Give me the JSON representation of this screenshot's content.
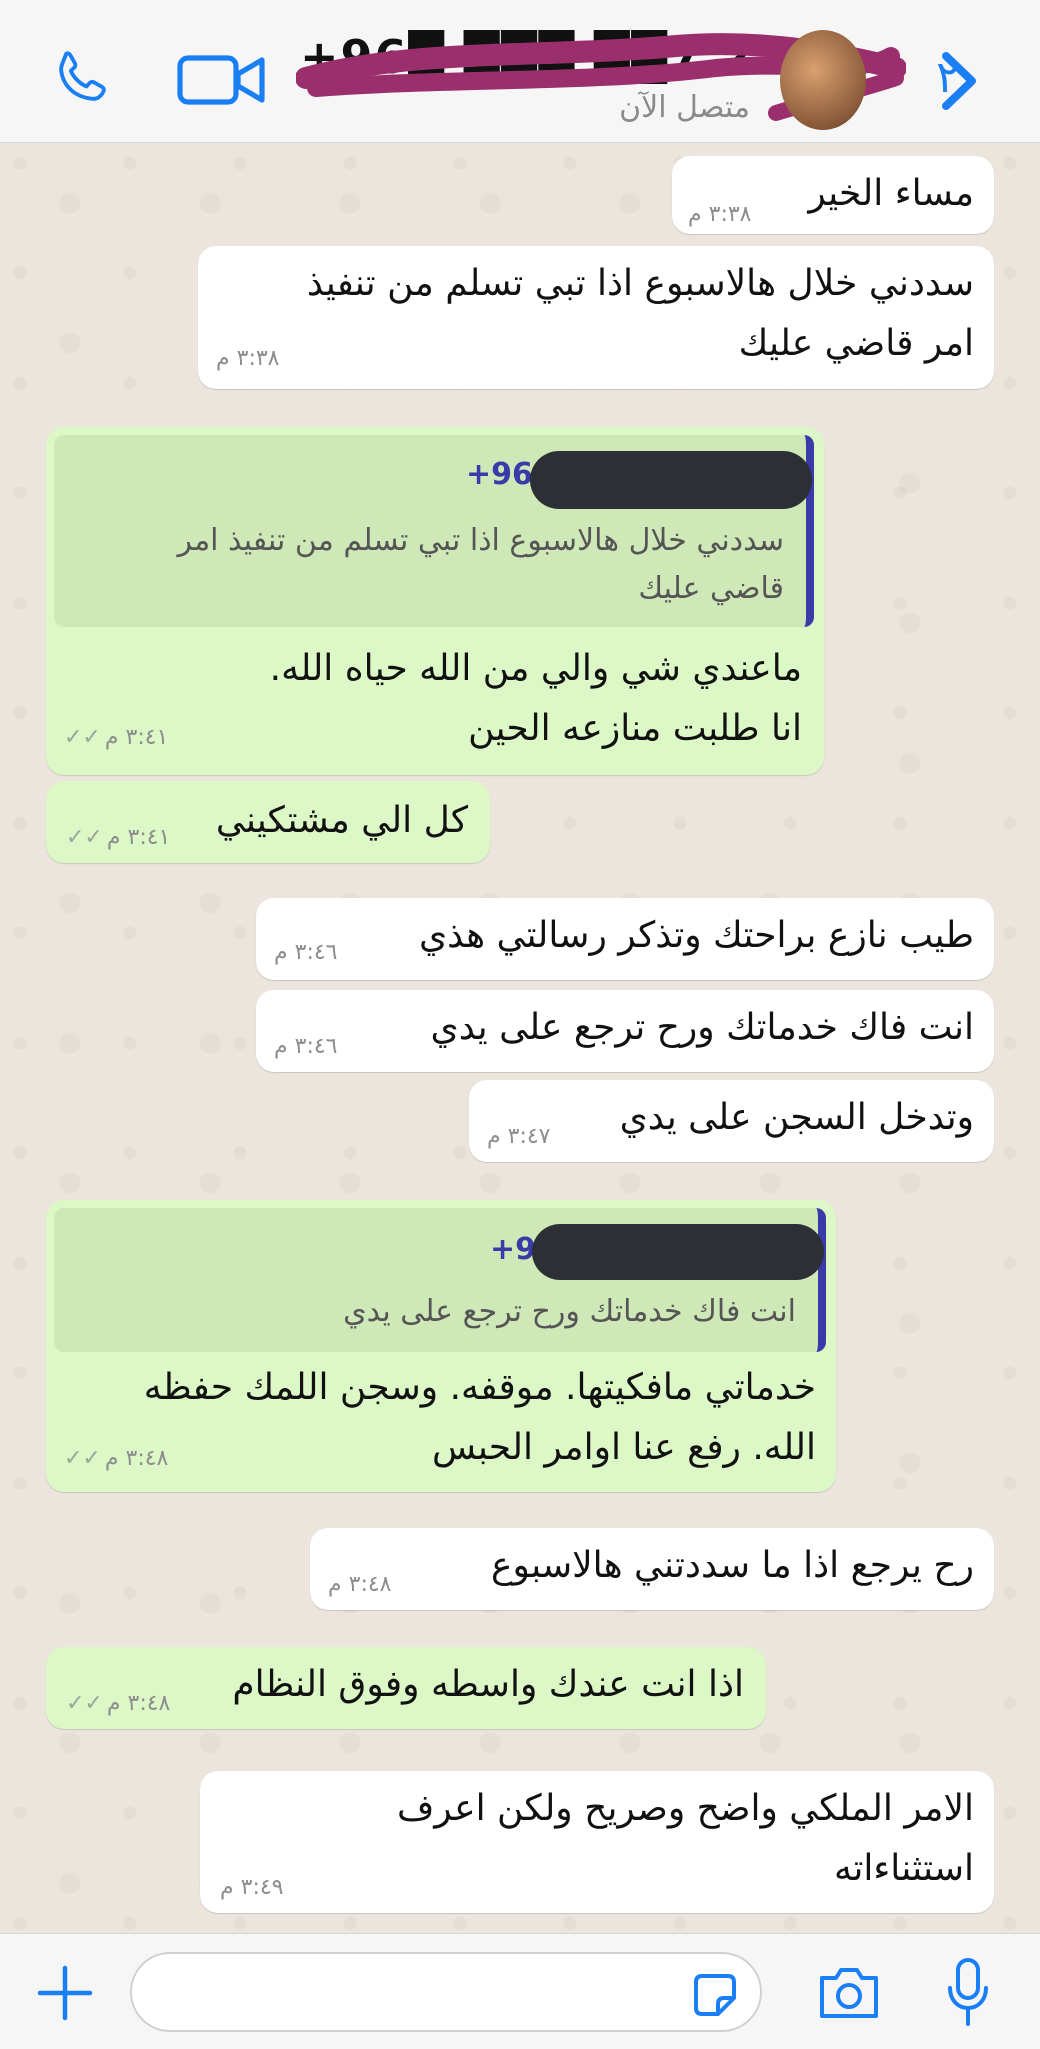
{
  "header": {
    "contact_name": "+96█ ███ ██7 2207",
    "status": "متصل الآن",
    "unread_count": "٢"
  },
  "messages": [
    {
      "text": "مساء الخير",
      "time": "٣:٣٨ م"
    },
    {
      "text": "سددني خلال هالاسبوع اذا تبي تسلم من تنفيذ\nامر قاضي عليك",
      "time": "٣:٣٨ م"
    },
    {
      "quote_sender": "+96",
      "quote_text": "سددني خلال هالاسبوع اذا تبي تسلم من تنفيذ امر\nقاضي عليك",
      "text": "ماعندي شي  والي من الله حياه الله.\nانا طلبت منازعه الحين",
      "time": "٣:٤١ م"
    },
    {
      "text": "كل الي مشتكيني",
      "time": "٣:٤١ م"
    },
    {
      "text": "طيب نازع براحتك وتذكر رسالتي هذي",
      "time": "٣:٤٦ م"
    },
    {
      "text": "انت فاك خدماتك ورح ترجع على يدي",
      "time": "٣:٤٦ م"
    },
    {
      "text": "وتدخل السجن على يدي",
      "time": "٣:٤٧ م"
    },
    {
      "quote_sender": "+9",
      "quote_text": "انت فاك خدماتك ورح ترجع على يدي",
      "text": "خدماتي مافكيتها. موقفه.  وسجن اللمك حفظه\nالله. رفع عنا اوامر الحبس",
      "time": "٣:٤٨ م"
    },
    {
      "text": "رح يرجع اذا ما سددتني هالاسبوع",
      "time": "٣:٤٨ م"
    },
    {
      "text": "اذا انت عندك واسطه وفوق النظام",
      "time": "٣:٤٨ م"
    },
    {
      "text": "الامر الملكي واضح وصريح ولكن اعرف\nاستثناءاته",
      "time": "٣:٤٩ م"
    }
  ],
  "composer": {
    "placeholder": ""
  },
  "colors": {
    "accent": "#1a7ef5",
    "outgoing": "#dcf8c6",
    "incoming": "#ffffff",
    "quote_bar": "#3a3aa8",
    "scribble": "#9b2f6e"
  },
  "icons": [
    "phone-icon",
    "video-icon",
    "back-chevron-icon",
    "plus-icon",
    "sticker-icon",
    "camera-icon",
    "mic-icon",
    "double-check-icon"
  ]
}
